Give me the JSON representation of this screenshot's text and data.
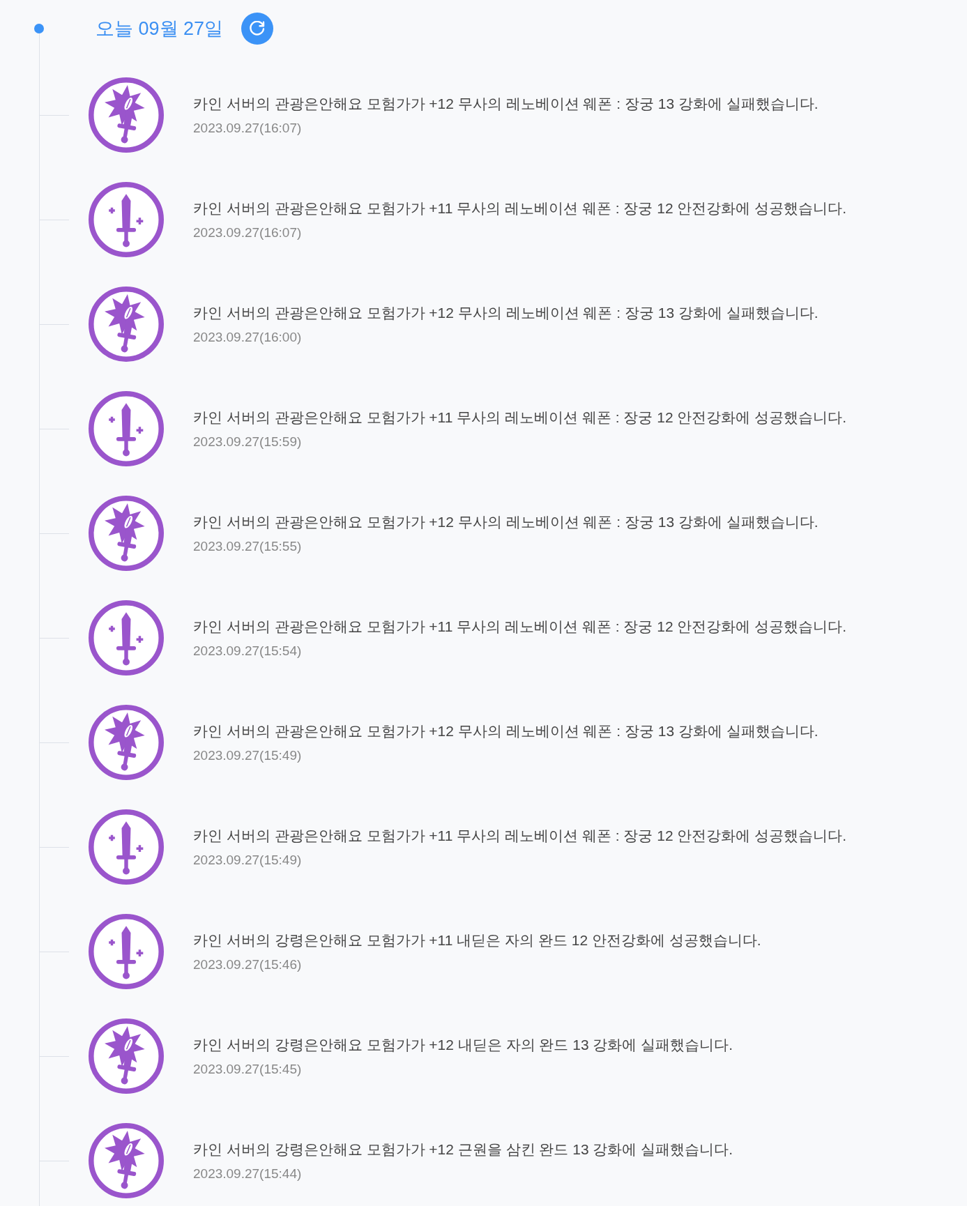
{
  "header": {
    "title": "오늘 09월 27일"
  },
  "entries": [
    {
      "kind": "failure",
      "message": "카인 서버의 관광은안해요 모험가가 +12 무사의 레노베이션 웨폰 : 장궁 13 강화에 실패했습니다.",
      "time": "2023.09.27(16:07)"
    },
    {
      "kind": "success",
      "message": "카인 서버의 관광은안해요 모험가가 +11 무사의 레노베이션 웨폰 : 장궁 12 안전강화에 성공했습니다.",
      "time": "2023.09.27(16:07)"
    },
    {
      "kind": "failure",
      "message": "카인 서버의 관광은안해요 모험가가 +12 무사의 레노베이션 웨폰 : 장궁 13 강화에 실패했습니다.",
      "time": "2023.09.27(16:00)"
    },
    {
      "kind": "success",
      "message": "카인 서버의 관광은안해요 모험가가 +11 무사의 레노베이션 웨폰 : 장궁 12 안전강화에 성공했습니다.",
      "time": "2023.09.27(15:59)"
    },
    {
      "kind": "failure",
      "message": "카인 서버의 관광은안해요 모험가가 +12 무사의 레노베이션 웨폰 : 장궁 13 강화에 실패했습니다.",
      "time": "2023.09.27(15:55)"
    },
    {
      "kind": "success",
      "message": "카인 서버의 관광은안해요 모험가가 +11 무사의 레노베이션 웨폰 : 장궁 12 안전강화에 성공했습니다.",
      "time": "2023.09.27(15:54)"
    },
    {
      "kind": "failure",
      "message": "카인 서버의 관광은안해요 모험가가 +12 무사의 레노베이션 웨폰 : 장궁 13 강화에 실패했습니다.",
      "time": "2023.09.27(15:49)"
    },
    {
      "kind": "success",
      "message": "카인 서버의 관광은안해요 모험가가 +11 무사의 레노베이션 웨폰 : 장궁 12 안전강화에 성공했습니다.",
      "time": "2023.09.27(15:49)"
    },
    {
      "kind": "success",
      "message": "카인 서버의 강령은안해요 모험가가 +11 내딛은 자의 완드 12 안전강화에 성공했습니다.",
      "time": "2023.09.27(15:46)"
    },
    {
      "kind": "failure",
      "message": "카인 서버의 강령은안해요 모험가가 +12 내딛은 자의 완드 13 강화에 실패했습니다.",
      "time": "2023.09.27(15:45)"
    },
    {
      "kind": "failure",
      "message": "카인 서버의 강령은안해요 모험가가 +12 근원을 삼킨 완드 13 강화에 실패했습니다.",
      "time": "2023.09.27(15:44)"
    }
  ]
}
